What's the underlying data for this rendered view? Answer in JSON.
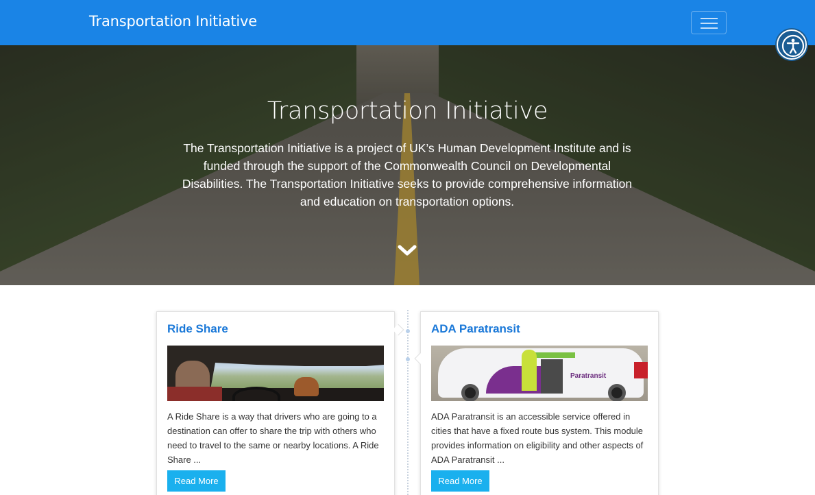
{
  "navbar": {
    "brand": "Transportation Initiative"
  },
  "hero": {
    "title": "Transportation Initiative",
    "description": "The Transportation Initiative is a project of UK’s Human Development Institute and is funded through the support of the Commonwealth Council on Developmental Disabilities. The Transportation Initiative seeks to provide comprehensive information and education on transportation options."
  },
  "cards": [
    {
      "title": "Ride Share",
      "text": "A Ride Share is a way that drivers who are going to a destination can offer to share the trip with others who need to travel to the same or nearby locations. A Ride Share ...",
      "button": "Read More"
    },
    {
      "title": "ADA Paratransit",
      "image_label": "Paratransit",
      "text": "ADA Paratransit is an accessible service offered in cities that have a fixed route bus system. This module provides information on eligibility and other aspects of ADA Paratransit ...",
      "button": "Read More"
    }
  ],
  "colors": {
    "navbar": "#1a84e6",
    "card_title": "#1a78d8",
    "button": "#1ab0ee"
  },
  "icons": [
    "menu-icon",
    "accessibility-icon",
    "chevron-down-icon"
  ]
}
